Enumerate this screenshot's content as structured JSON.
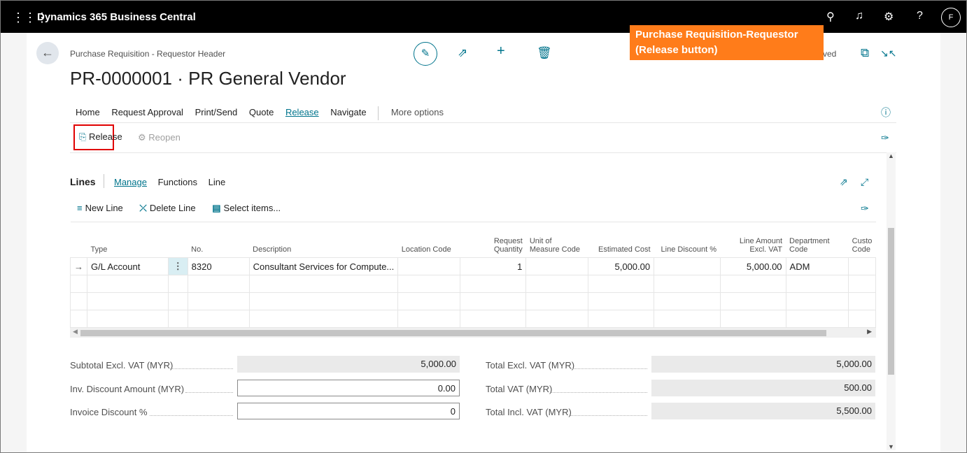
{
  "topbar": {
    "app_title": "Dynamics 365 Business Central",
    "avatar_initial": "F",
    "icons": [
      "waffle-icon",
      "search-icon",
      "bell-icon",
      "settings-icon",
      "help-icon"
    ]
  },
  "header": {
    "breadcrumb": "Purchase Requisition - Requestor Header",
    "title": "PR-0000001 · PR General Vendor",
    "saved_text": "ved"
  },
  "callout": {
    "line1": "Purchase Requisition-Requestor",
    "line2": "(Release button)",
    "color": "#ff7c1a"
  },
  "actionbar": {
    "items": [
      "Home",
      "Request Approval",
      "Print/Send",
      "Quote",
      "Release",
      "Navigate"
    ],
    "active": "Release",
    "more": "More options"
  },
  "release_group": {
    "release_label": "Release",
    "reopen_label": "Reopen"
  },
  "lines": {
    "title": "Lines",
    "tabs": [
      "Manage",
      "Functions",
      "Line"
    ],
    "actions": {
      "new_line": "New Line",
      "delete_line": "Delete Line",
      "select_items": "Select items..."
    },
    "columns": {
      "type": "Type",
      "no": "No.",
      "description": "Description",
      "location_code": "Location Code",
      "request_quantity_1": "Request",
      "request_quantity_2": "Quantity",
      "uom_1": "Unit of",
      "uom_2": "Measure Code",
      "estimated_cost": "Estimated Cost",
      "line_discount": "Line Discount %",
      "line_amount_1": "Line Amount",
      "line_amount_2": "Excl. VAT",
      "department_1": "Department",
      "department_2": "Code",
      "custo_1": "Custo",
      "custo_2": "Code"
    },
    "rows": [
      {
        "type": "G/L Account",
        "no": "8320",
        "description": "Consultant Services for Compute...",
        "location_code": "",
        "quantity": "1",
        "uom": "",
        "estimated_cost": "5,000.00",
        "line_discount": "",
        "line_amount": "5,000.00",
        "department": "ADM",
        "custo": ""
      }
    ]
  },
  "totals": {
    "subtotal_label": "Subtotal Excl. VAT (MYR)",
    "subtotal_value": "5,000.00",
    "inv_discount_label": "Inv. Discount Amount (MYR)",
    "inv_discount_value": "0.00",
    "invoice_discount_pct_label": "Invoice Discount %",
    "invoice_discount_pct_value": "0",
    "total_excl_label": "Total Excl. VAT (MYR)",
    "total_excl_value": "5,000.00",
    "total_vat_label": "Total VAT (MYR)",
    "total_vat_value": "500.00",
    "total_incl_label": "Total Incl. VAT (MYR)",
    "total_incl_value": "5,500.00"
  }
}
